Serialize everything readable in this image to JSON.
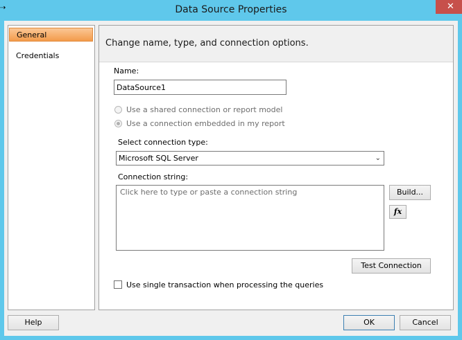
{
  "window": {
    "title": "Data Source Properties",
    "close_glyph": "✕"
  },
  "sidebar": {
    "items": [
      {
        "label": "General"
      },
      {
        "label": "Credentials"
      }
    ]
  },
  "main": {
    "header": "Change name, type, and connection options.",
    "name": {
      "label": "Name:",
      "value": "DataSource1"
    },
    "options": [
      {
        "label": "Use a shared connection or report model",
        "checked": false
      },
      {
        "label": "Use a connection embedded in my report",
        "checked": true
      }
    ],
    "connection_type": {
      "label": "Select connection type:",
      "value": "Microsoft SQL Server"
    },
    "connection_string": {
      "label": "Connection string:",
      "placeholder": "Click here to type or paste a connection string"
    },
    "build_label": "Build...",
    "fx_label": "fx",
    "test_connection_label": "Test Connection",
    "single_transaction": {
      "label": "Use single transaction when processing the queries",
      "checked": false
    }
  },
  "footer": {
    "help_label": "Help",
    "ok_label": "OK",
    "cancel_label": "Cancel"
  }
}
